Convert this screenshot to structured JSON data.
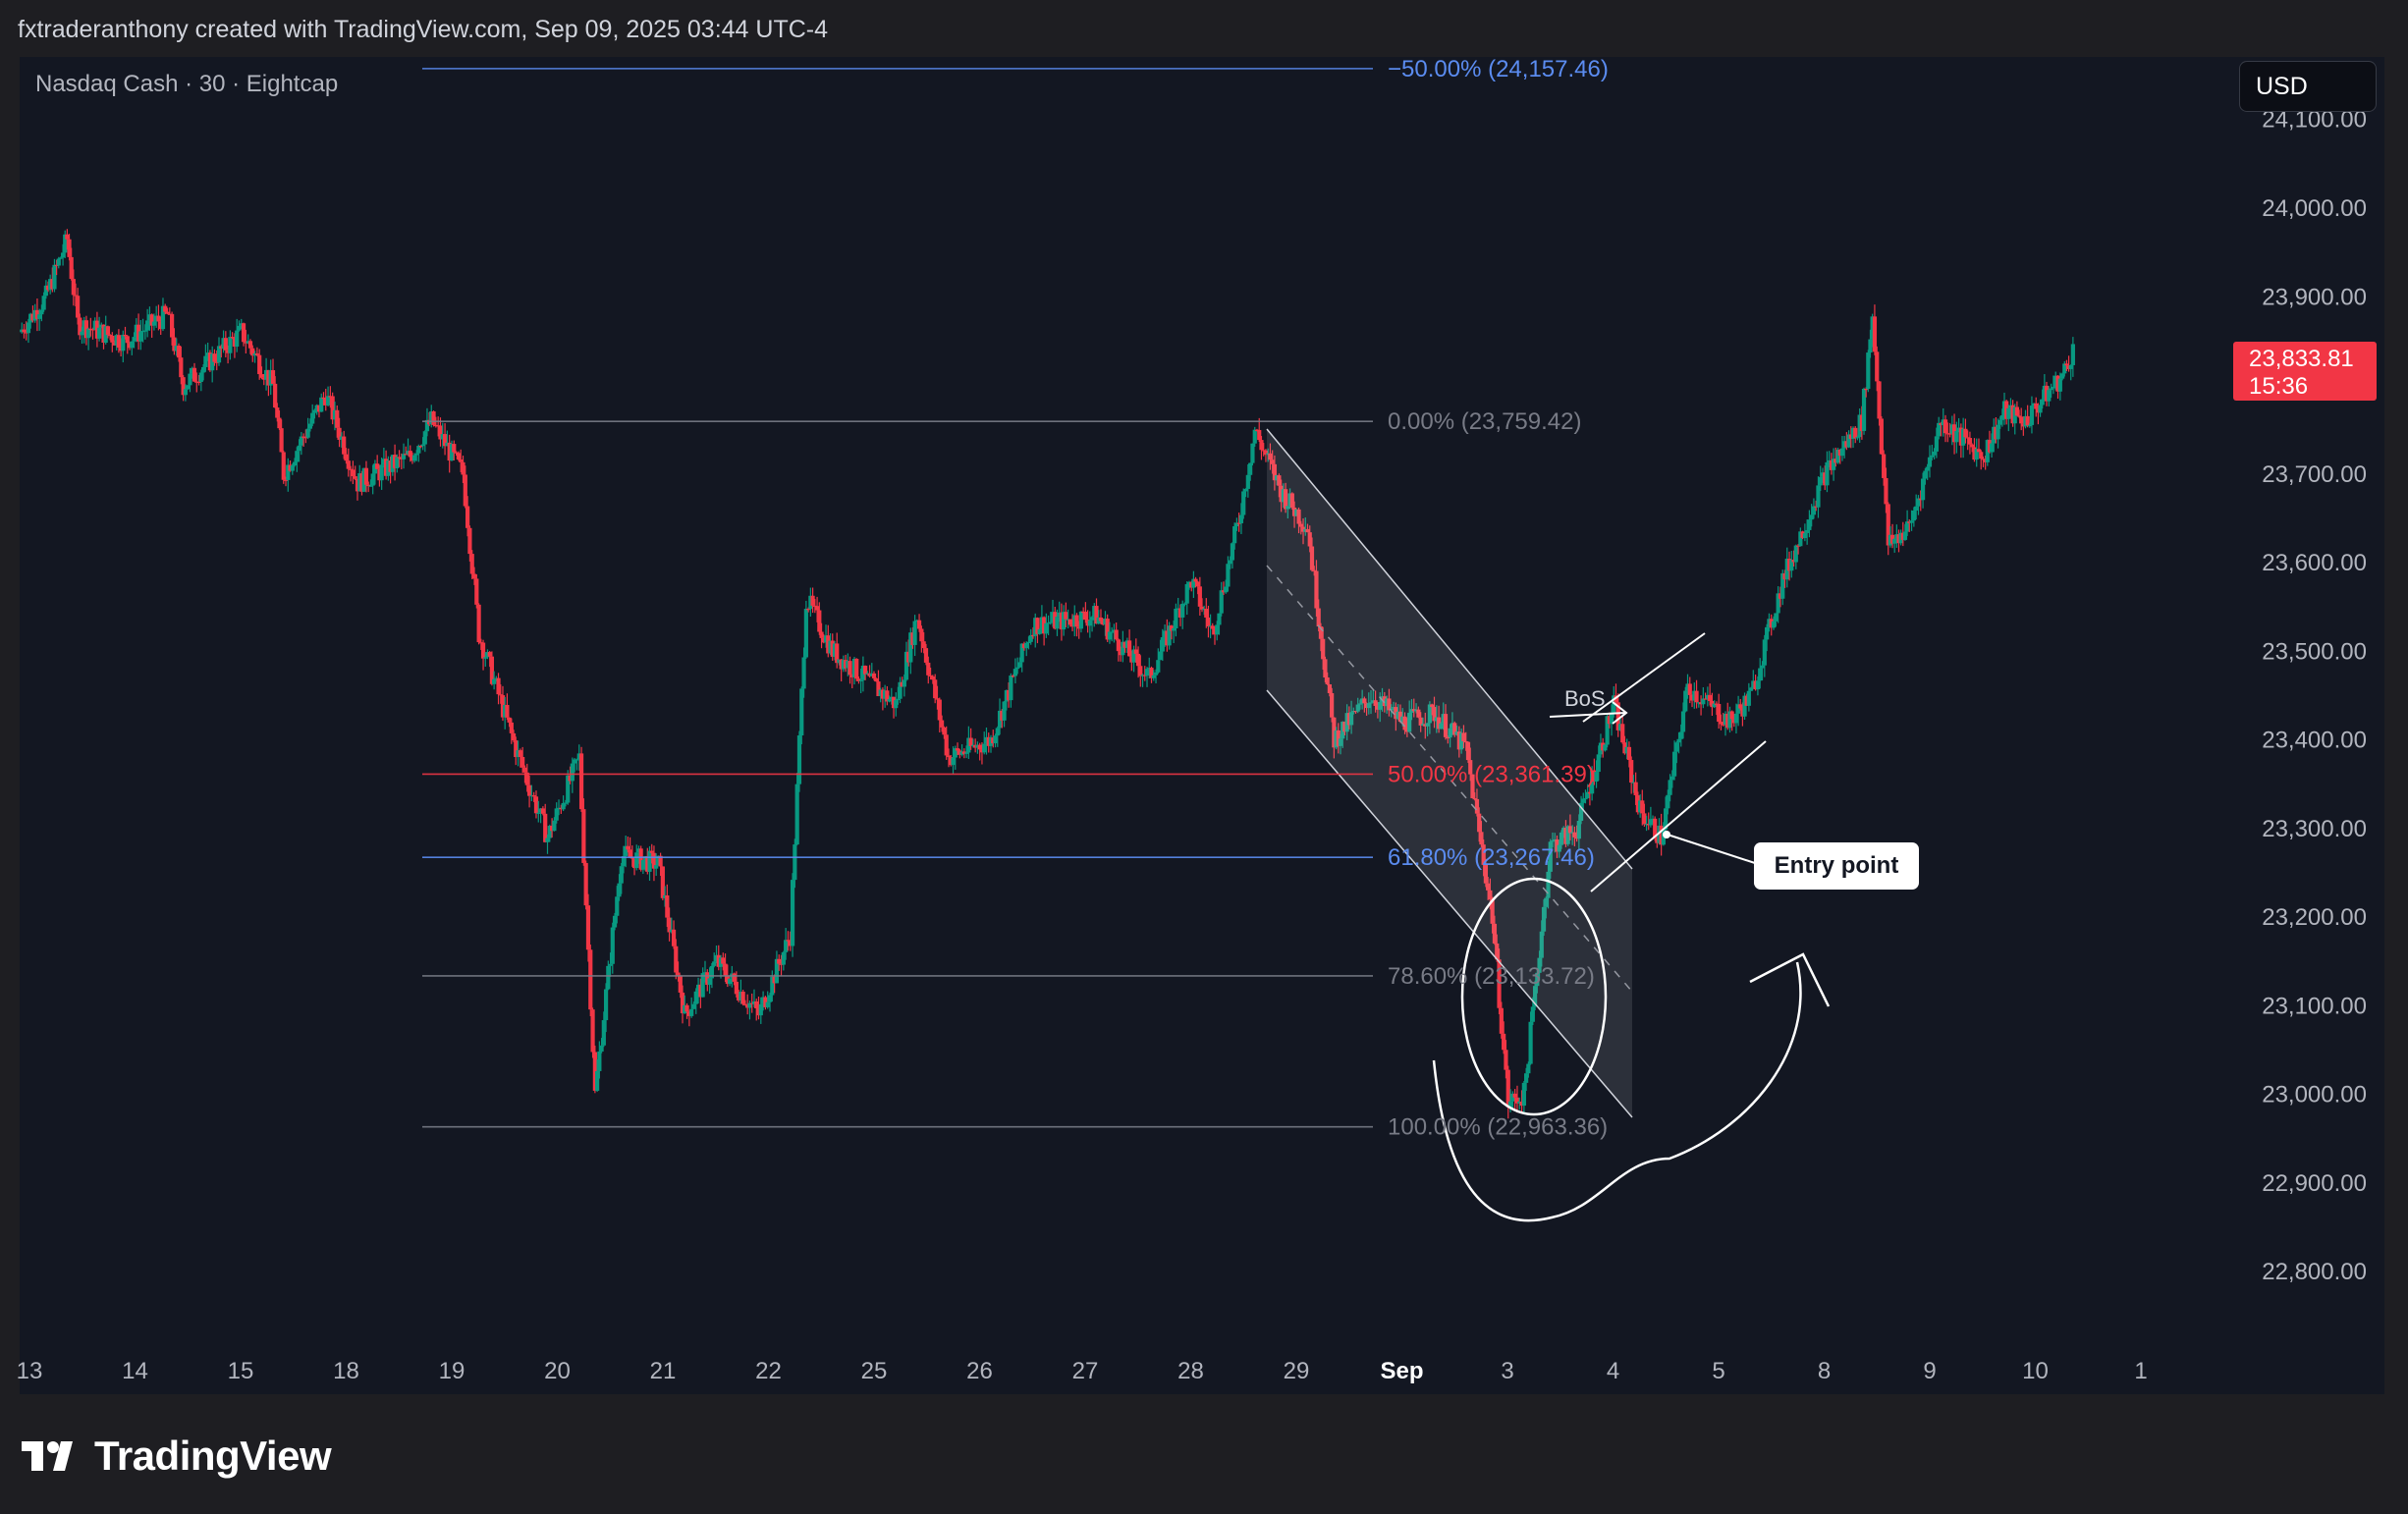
{
  "header": {
    "attribution": "fxtraderanthony created with TradingView.com, Sep 09, 2025 03:44 UTC-4"
  },
  "symbol_label": "Nasdaq Cash · 30 · Eightcap",
  "currency": "USD",
  "price_tag": {
    "price": "23,833.81",
    "countdown": "15:36"
  },
  "brand": {
    "name": "TradingView"
  },
  "colors": {
    "background": "#131722",
    "up": "#089981",
    "down": "#f23645",
    "fib_blue": "#5b8cf0",
    "fib_red": "#f23645"
  },
  "annotations": {
    "entry_label": "Entry point",
    "bos_label": "BoS"
  },
  "chart_data": {
    "type": "candlestick",
    "title": "Nasdaq Cash · 30 · Eightcap",
    "ylim": [
      22700,
      24200
    ],
    "x_ticks": [
      "13",
      "14",
      "15",
      "18",
      "19",
      "20",
      "21",
      "22",
      "25",
      "26",
      "27",
      "28",
      "29",
      "Sep",
      "3",
      "4",
      "5",
      "8",
      "9",
      "10",
      "1"
    ],
    "y_ticks": [
      "24,100.00",
      "24,000.00",
      "23,900.00",
      "23,800.00",
      "23,700.00",
      "23,600.00",
      "23,500.00",
      "23,400.00",
      "23,300.00",
      "23,200.00",
      "23,100.00",
      "23,000.00",
      "22,900.00",
      "22,800.00"
    ],
    "y_tick_values": [
      24100,
      24000,
      23900,
      23800,
      23700,
      23600,
      23500,
      23400,
      23300,
      23200,
      23100,
      23000,
      22900,
      22800
    ],
    "last_price": 23833.81,
    "fib_levels": [
      {
        "label": "−50.00% (24,157.46)",
        "value": 24157.46,
        "color": "#5b8cf0"
      },
      {
        "label": "0.00% (23,759.42)",
        "value": 23759.42,
        "color": "#787b86"
      },
      {
        "label": "50.00% (23,361.39)",
        "value": 23361.39,
        "color": "#f23645"
      },
      {
        "label": "61.80% (23,267.46)",
        "value": 23267.46,
        "color": "#5b8cf0"
      },
      {
        "label": "78.60% (23,133.72)",
        "value": 23133.72,
        "color": "#787b86"
      },
      {
        "label": "100.00% (22,963.36)",
        "value": 22963.36,
        "color": "#787b86"
      }
    ],
    "price_path": [
      {
        "d": 0.0,
        "p": 23860
      },
      {
        "d": 0.25,
        "p": 23900
      },
      {
        "d": 0.45,
        "p": 23965
      },
      {
        "d": 0.55,
        "p": 23870
      },
      {
        "d": 1.0,
        "p": 23850
      },
      {
        "d": 1.4,
        "p": 23880
      },
      {
        "d": 1.55,
        "p": 23800
      },
      {
        "d": 2.1,
        "p": 23860
      },
      {
        "d": 2.4,
        "p": 23800
      },
      {
        "d": 2.5,
        "p": 23700
      },
      {
        "d": 2.9,
        "p": 23790
      },
      {
        "d": 3.2,
        "p": 23690
      },
      {
        "d": 3.7,
        "p": 23720
      },
      {
        "d": 3.9,
        "p": 23760
      },
      {
        "d": 4.2,
        "p": 23700
      },
      {
        "d": 4.35,
        "p": 23520
      },
      {
        "d": 4.7,
        "p": 23390
      },
      {
        "d": 5.0,
        "p": 23290
      },
      {
        "d": 5.3,
        "p": 23380
      },
      {
        "d": 5.45,
        "p": 23000
      },
      {
        "d": 5.7,
        "p": 23270
      },
      {
        "d": 6.05,
        "p": 23260
      },
      {
        "d": 6.3,
        "p": 23090
      },
      {
        "d": 6.6,
        "p": 23150
      },
      {
        "d": 7.0,
        "p": 23090
      },
      {
        "d": 7.3,
        "p": 23180
      },
      {
        "d": 7.45,
        "p": 23560
      },
      {
        "d": 7.7,
        "p": 23500
      },
      {
        "d": 8.3,
        "p": 23440
      },
      {
        "d": 8.5,
        "p": 23540
      },
      {
        "d": 8.8,
        "p": 23380
      },
      {
        "d": 9.2,
        "p": 23400
      },
      {
        "d": 9.6,
        "p": 23530
      },
      {
        "d": 10.2,
        "p": 23540
      },
      {
        "d": 10.7,
        "p": 23470
      },
      {
        "d": 11.1,
        "p": 23580
      },
      {
        "d": 11.3,
        "p": 23520
      },
      {
        "d": 11.55,
        "p": 23650
      },
      {
        "d": 11.7,
        "p": 23750
      },
      {
        "d": 11.95,
        "p": 23680
      },
      {
        "d": 12.2,
        "p": 23640
      },
      {
        "d": 12.45,
        "p": 23400
      },
      {
        "d": 12.8,
        "p": 23450
      },
      {
        "d": 13.1,
        "p": 23420
      },
      {
        "d": 13.4,
        "p": 23430
      },
      {
        "d": 13.7,
        "p": 23390
      },
      {
        "d": 13.95,
        "p": 23200
      },
      {
        "d": 14.1,
        "p": 22990
      },
      {
        "d": 14.25,
        "p": 23000
      },
      {
        "d": 14.5,
        "p": 23280
      },
      {
        "d": 14.75,
        "p": 23300
      },
      {
        "d": 15.1,
        "p": 23440
      },
      {
        "d": 15.35,
        "p": 23320
      },
      {
        "d": 15.55,
        "p": 23290
      },
      {
        "d": 15.8,
        "p": 23460
      },
      {
        "d": 16.2,
        "p": 23420
      },
      {
        "d": 16.4,
        "p": 23450
      },
      {
        "d": 16.7,
        "p": 23580
      },
      {
        "d": 17.1,
        "p": 23700
      },
      {
        "d": 17.45,
        "p": 23760
      },
      {
        "d": 17.55,
        "p": 23880
      },
      {
        "d": 17.7,
        "p": 23620
      },
      {
        "d": 17.9,
        "p": 23640
      },
      {
        "d": 18.2,
        "p": 23760
      },
      {
        "d": 18.6,
        "p": 23720
      },
      {
        "d": 18.8,
        "p": 23770
      },
      {
        "d": 19.0,
        "p": 23760
      },
      {
        "d": 19.2,
        "p": 23790
      },
      {
        "d": 19.35,
        "p": 23810
      },
      {
        "d": 19.45,
        "p": 23840
      }
    ]
  }
}
